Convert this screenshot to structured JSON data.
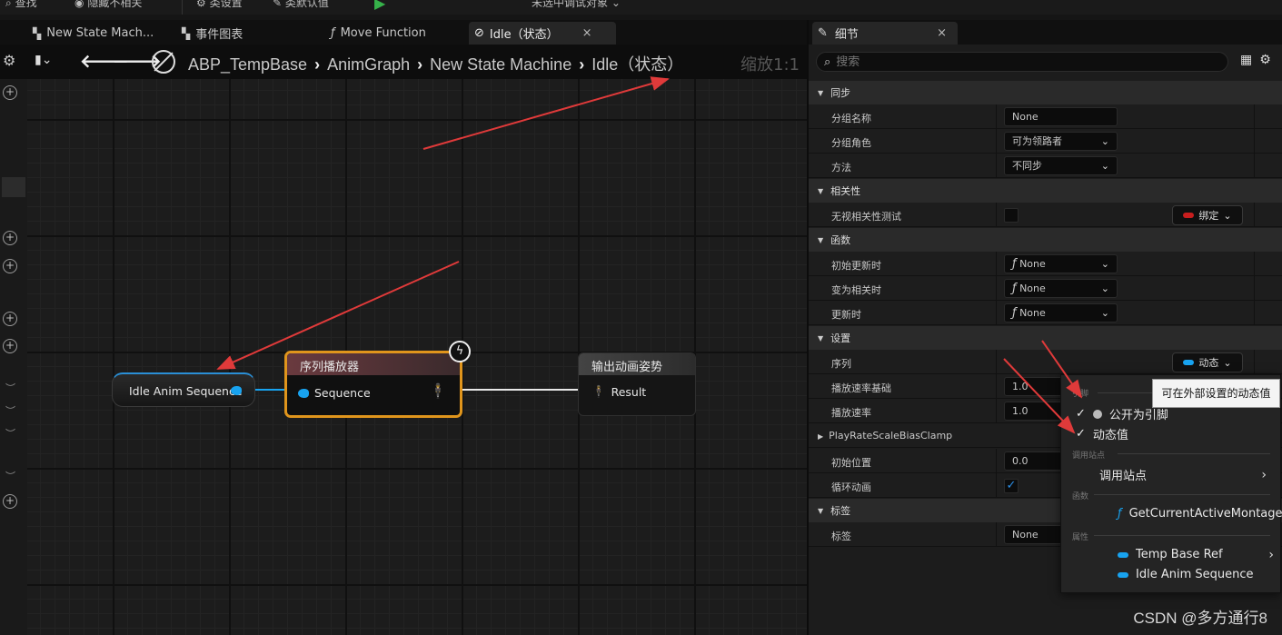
{
  "toolbar": {
    "find": "查找",
    "hide_unrelated": "隐藏不相关",
    "class_settings": "类设置",
    "class_defaults": "类默认值",
    "debug_target": "未选中调试对象"
  },
  "tabs": [
    {
      "label": "New State Mach...",
      "icon": "state-machine-icon"
    },
    {
      "label": "事件图表",
      "icon": "event-graph-icon"
    },
    {
      "label": "Move Function",
      "icon": "function-icon"
    },
    {
      "label": "Idle（状态）",
      "icon": "state-icon",
      "close": "×"
    }
  ],
  "breadcrumb": {
    "items": [
      "ABP_TempBase",
      "AnimGraph",
      "New State Machine",
      "Idle（状态）"
    ],
    "zoom": "缩放1:1"
  },
  "nodes": {
    "idle_anim": {
      "label": "Idle Anim Sequence"
    },
    "sequence_player": {
      "title": "序列播放器",
      "pin": "Sequence"
    },
    "output_pose": {
      "title": "输出动画姿势",
      "pin": "Result"
    }
  },
  "details": {
    "tab_title": "细节",
    "tab_close": "×",
    "search_placeholder": "搜索",
    "categories": {
      "sync": "同步",
      "relevancy": "相关性",
      "functions": "函数",
      "settings": "设置",
      "tags": "标签"
    },
    "rows": {
      "group_name": {
        "key": "分组名称",
        "value": "None"
      },
      "group_role": {
        "key": "分组角色",
        "value": "可为领路者"
      },
      "method": {
        "key": "方法",
        "value": "不同步"
      },
      "ignore_relevancy": {
        "key": "无视相关性测试",
        "bind": "绑定"
      },
      "initial_update": {
        "key": "初始更新时",
        "value": "None"
      },
      "become_relevant": {
        "key": "变为相关时",
        "value": "None"
      },
      "on_update": {
        "key": "更新时",
        "value": "None"
      },
      "sequence": {
        "key": "序列",
        "dynamic": "动态"
      },
      "play_rate_basis": {
        "key": "播放速率基础",
        "value": "1.0"
      },
      "play_rate": {
        "key": "播放速率",
        "value": "1.0"
      },
      "bias_clamp": {
        "key": "PlayRateScaleBiasClamp"
      },
      "start_position": {
        "key": "初始位置",
        "value": "0.0"
      },
      "loop": {
        "key": "循环动画",
        "checked": true
      },
      "tag": {
        "key": "标签",
        "value": "None"
      }
    }
  },
  "popup": {
    "section_pin": "引脚",
    "expose_pin": "公开为引脚",
    "dynamic_value": "动态值",
    "section_call_site": "调用站点",
    "call_site": "调用站点",
    "section_function": "函数",
    "function_item": "GetCurrentActiveMontage",
    "section_property": "属性",
    "prop_temp_base": "Temp Base Ref",
    "prop_idle_anim": "Idle Anim Sequence"
  },
  "tooltip": "可在外部设置的动态值",
  "watermark": "CSDN @多方通行8",
  "colors": {
    "pin_blue": "#18a3f0",
    "selected_border": "#e0951c",
    "annotation_arrow": "#e03a3a",
    "binding_red": "#c81e1e"
  }
}
